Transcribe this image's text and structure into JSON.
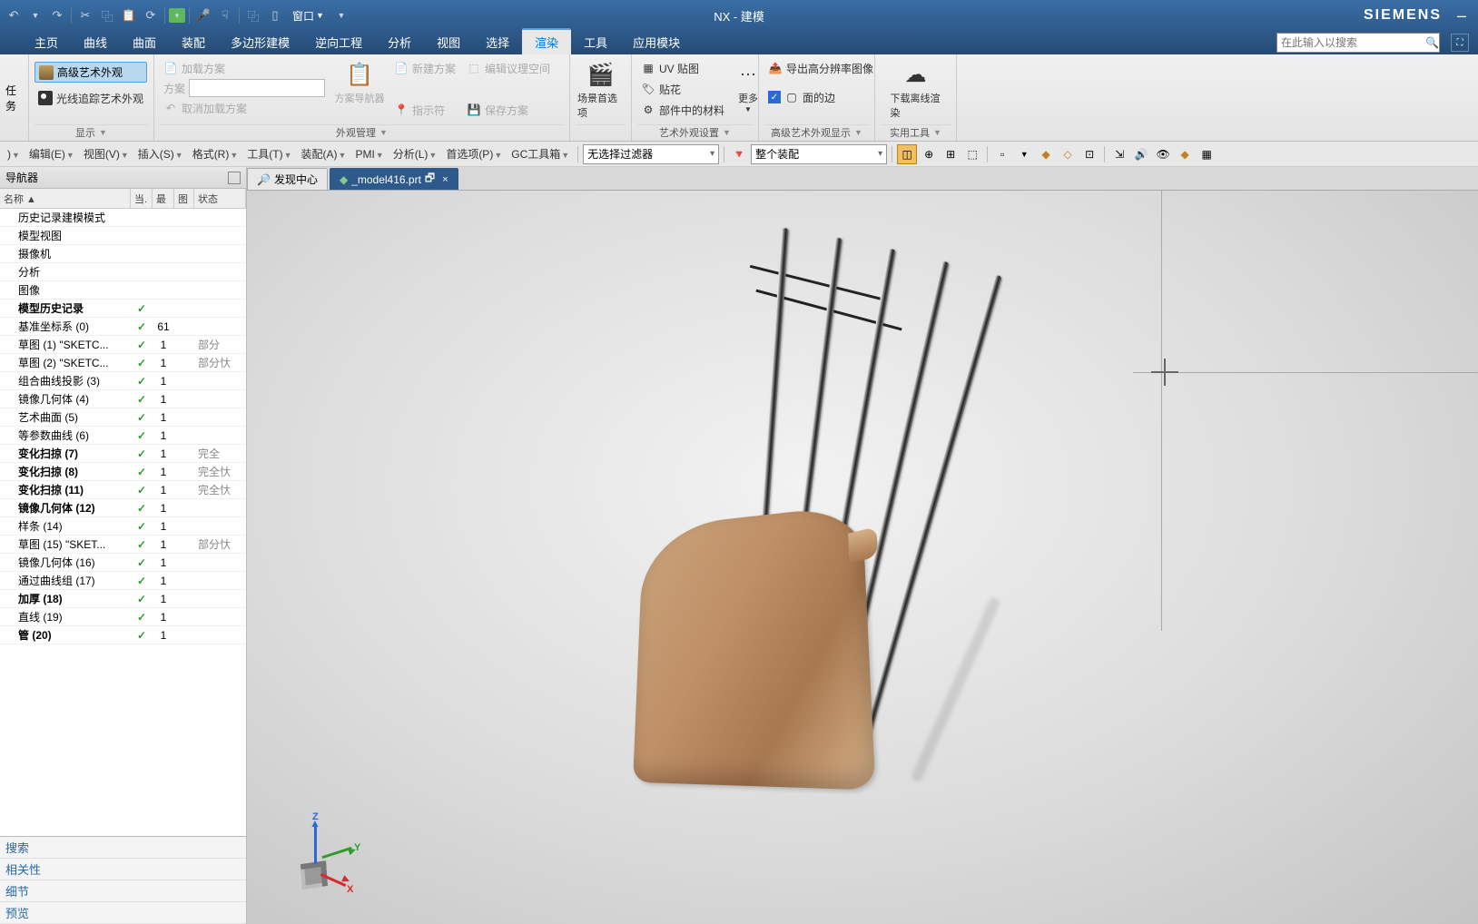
{
  "title": "NX - 建模",
  "brand": "SIEMENS",
  "qat_window": "窗口",
  "menus": [
    "主页",
    "曲线",
    "曲面",
    "装配",
    "多边形建模",
    "逆向工程",
    "分析",
    "视图",
    "选择",
    "渲染",
    "工具",
    "应用模块"
  ],
  "active_menu_index": 9,
  "search_placeholder": "在此输入以搜索",
  "ribbon": {
    "left_task": "任务",
    "display": {
      "adv_artistic": "高级艺术外观",
      "raytrace": "光线追踪艺术外观",
      "label": "显示"
    },
    "appearance_mgr": {
      "load_scheme": "加载方案",
      "scheme": "方案",
      "cancel_load": "取消加载方案",
      "scheme_nav": "方案导航器",
      "new_scheme": "新建方案",
      "indicator": "指示符",
      "edit_space": "编辑议理空间",
      "save_scheme": "保存方案",
      "label": "外观管理"
    },
    "scene": {
      "label": "场景首选项"
    },
    "art_settings": {
      "uv_map": "UV 贴图",
      "decal": "贴花",
      "part_materials": "部件中的材料",
      "more": "更多",
      "label": "艺术外观设置"
    },
    "adv_disp": {
      "export_hires": "导出高分辨率图像",
      "face_edges": "面的边",
      "label": "高级艺术外观显示"
    },
    "util": {
      "download_offline": "下载离线渲染",
      "label": "实用工具"
    }
  },
  "menubar2": {
    "items": [
      "编辑(E)",
      "视图(V)",
      "插入(S)",
      "格式(R)",
      "工具(T)",
      "装配(A)",
      "PMI",
      "分析(L)",
      "首选项(P)",
      "GC工具箱"
    ],
    "filter": "无选择过滤器",
    "scope": "整个装配"
  },
  "nav": {
    "title": "导航器",
    "cols": [
      "名称 ▲",
      "当.",
      "最",
      "图",
      "状态"
    ],
    "tree": [
      {
        "name": "历史记录建模模式",
        "bold": false
      },
      {
        "name": "模型视图"
      },
      {
        "name": "摄像机"
      },
      {
        "name": "分析"
      },
      {
        "name": "图像"
      },
      {
        "name": "模型历史记录",
        "bold": true,
        "check": true
      },
      {
        "name": "基准坐标系 (0)",
        "check": true,
        "최": "61"
      },
      {
        "name": "草图 (1) \"SKETC...",
        "check": true,
        "최": "1",
        "stat": "部分"
      },
      {
        "name": "草图 (2) \"SKETC...",
        "check": true,
        "최": "1",
        "stat": "部分忕"
      },
      {
        "name": "组合曲线投影 (3)",
        "check": true,
        "최": "1"
      },
      {
        "name": "镜像几何体 (4)",
        "check": true,
        "최": "1"
      },
      {
        "name": "艺术曲面 (5)",
        "check": true,
        "최": "1"
      },
      {
        "name": "等参数曲线 (6)",
        "check": true,
        "최": "1"
      },
      {
        "name": "变化扫掠 (7)",
        "check": true,
        "최": "1",
        "stat": "完全",
        "bold": true
      },
      {
        "name": "变化扫掠 (8)",
        "check": true,
        "최": "1",
        "stat": "完全忕",
        "bold": true
      },
      {
        "name": "变化扫掠 (11)",
        "check": true,
        "최": "1",
        "stat": "完全忕",
        "bold": true
      },
      {
        "name": "镜像几何体 (12)",
        "check": true,
        "최": "1",
        "bold": true
      },
      {
        "name": "样条 (14)",
        "check": true,
        "최": "1"
      },
      {
        "name": "草图 (15) \"SKET...",
        "check": true,
        "최": "1",
        "stat": "部分忕"
      },
      {
        "name": "镜像几何体 (16)",
        "check": true,
        "최": "1"
      },
      {
        "name": "通过曲线组 (17)",
        "check": true,
        "최": "1"
      },
      {
        "name": "加厚 (18)",
        "check": true,
        "최": "1",
        "bold": true
      },
      {
        "name": "直线 (19)",
        "check": true,
        "최": "1"
      },
      {
        "name": "管 (20)",
        "check": true,
        "최": "1",
        "bold": true
      }
    ],
    "footer": [
      "搜索",
      "相关性",
      "细节",
      "预览"
    ]
  },
  "doc_tabs": [
    {
      "label": "发现中心",
      "active": false
    },
    {
      "label": "_model416.prt",
      "active": true,
      "modified": true
    }
  ],
  "triad": {
    "x": "X",
    "y": "Y",
    "z": "Z"
  }
}
